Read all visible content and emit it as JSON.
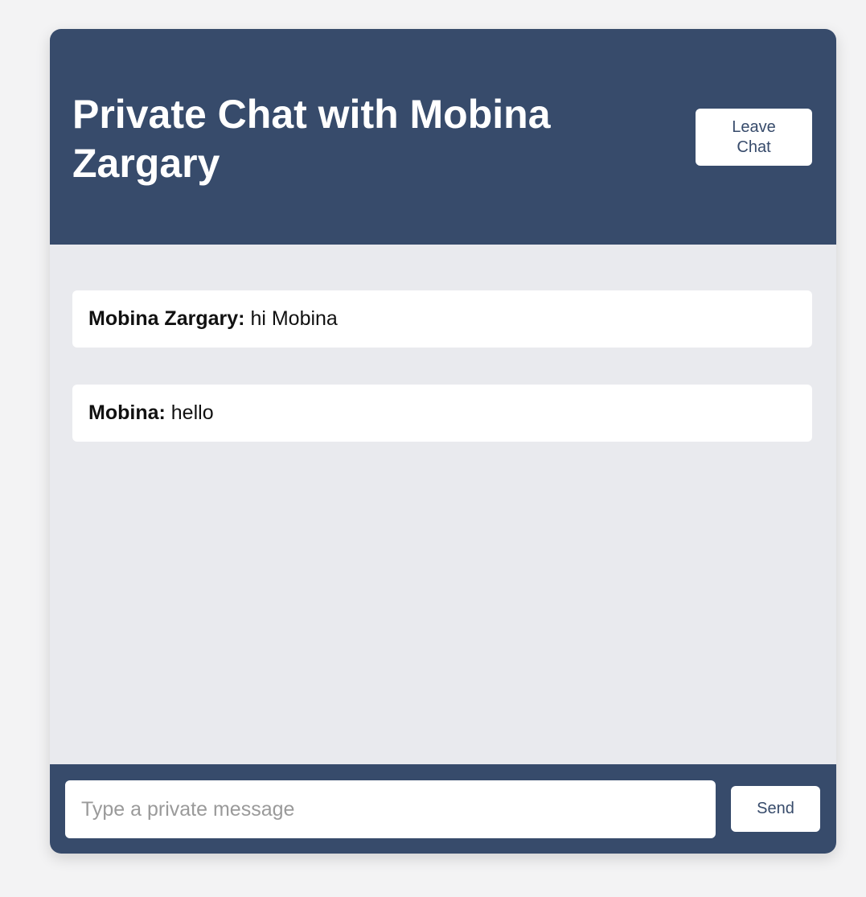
{
  "header": {
    "title": "Private Chat with Mobina Zargary",
    "leave_label": "Leave Chat"
  },
  "messages": [
    {
      "sender": "Mobina Zargary:",
      "text": "hi Mobina"
    },
    {
      "sender": "Mobina:",
      "text": "hello"
    }
  ],
  "composer": {
    "placeholder": "Type a private message",
    "value": "",
    "send_label": "Send"
  },
  "colors": {
    "accent": "#374b6b",
    "message_area": "#e9eaee",
    "page_background": "#f3f3f4"
  }
}
